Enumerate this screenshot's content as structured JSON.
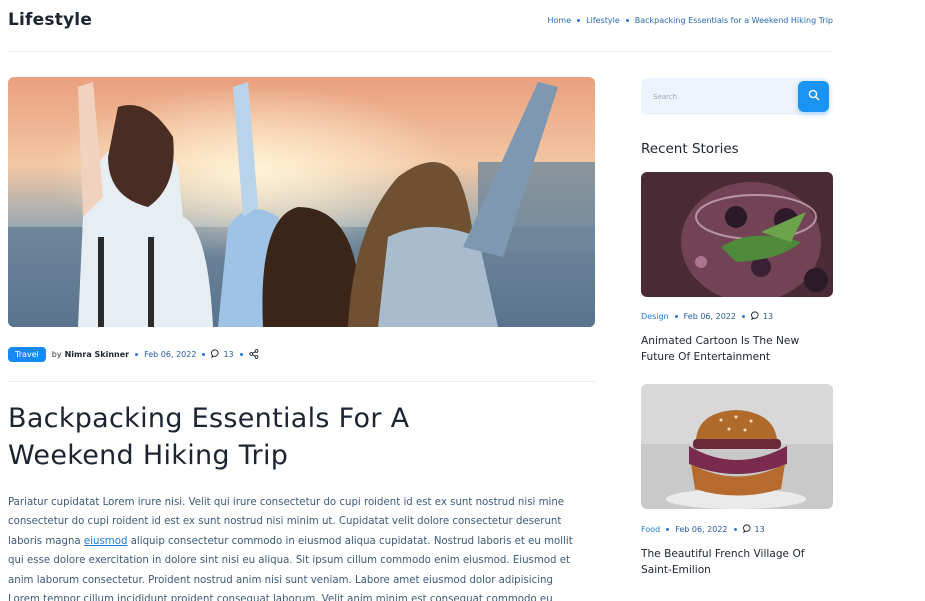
{
  "site": {
    "title": "Lifestyle"
  },
  "breadcrumb": [
    "Home",
    "Lifestyle",
    "Backpacking Essentials for a Weekend Hiking Trip"
  ],
  "article": {
    "category": "Travel",
    "by_label": "by",
    "author": "Nimra Skinner",
    "date": "Feb 06, 2022",
    "comments": "13",
    "title": "Backpacking Essentials For A Weekend Hiking Trip",
    "body_before_link": "Pariatur cupidatat Lorem irure nisi. Velit qui irure consectetur do cupi roident id est ex sunt nostrud nisi mine consectetur do cupi roident id est ex sunt nostrud nisi minim ut. Cupidatat velit dolore consectetur deserunt laboris magna ",
    "body_link": "eiusmod",
    "body_after_link": " aliquip consectetur commodo in eiusmod aliqua cupidatat. Nostrud laboris et eu mollit qui esse dolore exercitation in dolore sint nisi eu aliqua. Sit ipsum cillum commodo enim eiusmod. Eiusmod et anim laborum consectetur. Proident nostrud anim nisi sunt veniam. Labore amet eiusmod dolor adipisicing Lorem tempor cillum incididunt proident consequat laborum. Velit anim minim est consequat commodo eu reprehenderit eiusmod nisi amet."
  },
  "sidebar": {
    "search_placeholder": "Search",
    "recent_heading": "Recent Stories",
    "stories": [
      {
        "category": "Design",
        "date": "Feb 06, 2022",
        "comments": "13",
        "title": "Animated Cartoon Is The New Future Of Entertainment"
      },
      {
        "category": "Food",
        "date": "Feb 06, 2022",
        "comments": "13",
        "title": "The Beautiful French Village Of Saint-Emilion"
      }
    ]
  },
  "colors": {
    "accent": "#1a94f4",
    "link": "#1e7bd8",
    "text": "#1b2430"
  },
  "icons": {
    "comment": "comment-icon",
    "share": "share-icon",
    "search": "search-icon"
  }
}
